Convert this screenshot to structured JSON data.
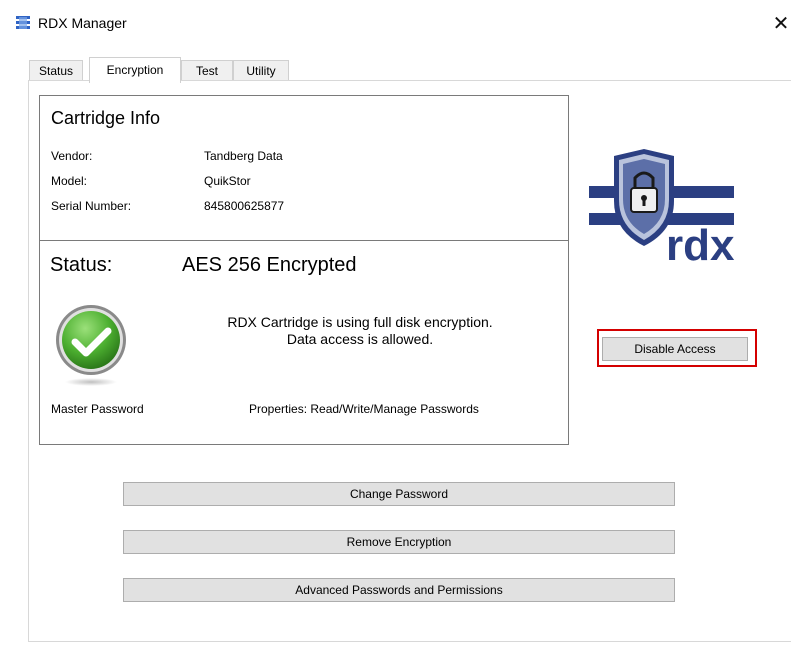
{
  "window": {
    "title": "RDX Manager",
    "close_glyph": "✕"
  },
  "tabs": [
    {
      "label": "Status"
    },
    {
      "label": "Encryption",
      "active": true
    },
    {
      "label": "Test"
    },
    {
      "label": "Utility"
    }
  ],
  "cartridge": {
    "heading": "Cartridge Info",
    "vendor_label": "Vendor:",
    "vendor": "Tandberg Data",
    "model_label": "Model:",
    "model": "QuikStor",
    "serial_label": "Serial Number:",
    "serial": "845800625877"
  },
  "status": {
    "label": "Status:",
    "value": "AES 256 Encrypted",
    "message_line1": "RDX Cartridge is using full disk encryption.",
    "message_line2": "Data access is allowed.",
    "role": "Master Password",
    "properties": "Properties: Read/Write/Manage Passwords"
  },
  "logo": {
    "text": "rdx",
    "brand_color": "#2b3f82"
  },
  "buttons": {
    "disable_access": "Disable Access",
    "change_password": "Change Password",
    "remove_encryption": "Remove Encryption",
    "advanced": "Advanced Passwords and Permissions"
  },
  "colors": {
    "highlight": "#d40000",
    "check_green": "#4caf30"
  }
}
